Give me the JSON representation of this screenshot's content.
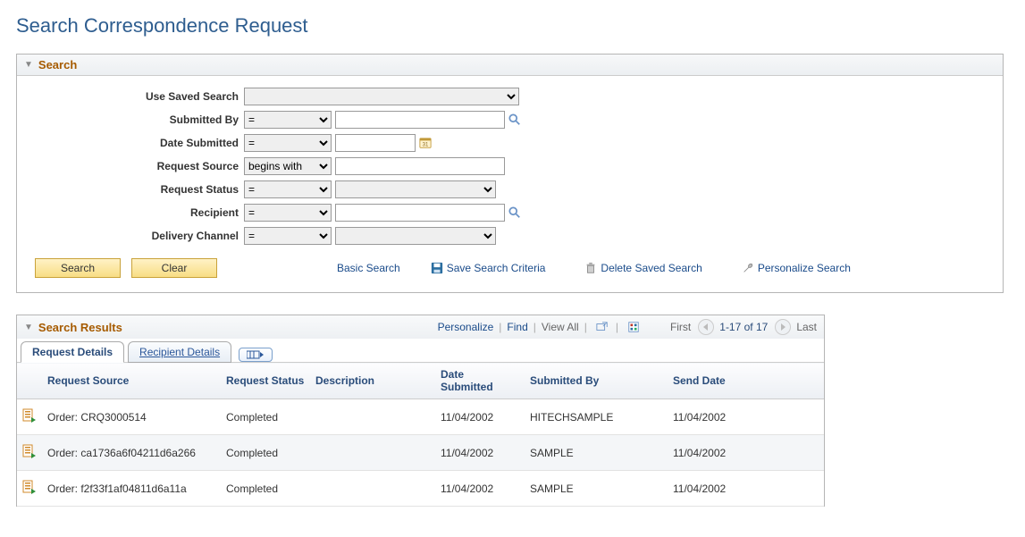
{
  "page": {
    "title": "Search Correspondence Request"
  },
  "searchPanel": {
    "title": "Search",
    "fields": {
      "useSavedSearch": {
        "label": "Use Saved Search",
        "value": ""
      },
      "submittedBy": {
        "label": "Submitted By",
        "op": "=",
        "value": ""
      },
      "dateSubmitted": {
        "label": "Date Submitted",
        "op": "=",
        "value": ""
      },
      "requestSource": {
        "label": "Request Source",
        "op": "begins with",
        "value": ""
      },
      "requestStatus": {
        "label": "Request Status",
        "op": "=",
        "value": ""
      },
      "recipient": {
        "label": "Recipient",
        "op": "=",
        "value": ""
      },
      "deliveryChannel": {
        "label": "Delivery Channel",
        "op": "=",
        "value": ""
      }
    },
    "buttons": {
      "search": "Search",
      "clear": "Clear"
    },
    "links": {
      "basicSearch": "Basic Search",
      "saveCriteria": "Save Search Criteria",
      "deleteSaved": "Delete Saved Search",
      "personalize": "Personalize Search"
    }
  },
  "resultsPanel": {
    "title": "Search Results",
    "toolbar": {
      "personalize": "Personalize",
      "find": "Find",
      "viewAll": "View All",
      "firstLabel": "First",
      "rangeLabel": "1-17 of 17",
      "lastLabel": "Last"
    },
    "tabs": {
      "requestDetails": "Request Details",
      "recipientDetails": "Recipient Details"
    },
    "columns": {
      "requestSource": "Request Source",
      "requestStatus": "Request Status",
      "description": "Description",
      "dateSubmitted": "Date Submitted",
      "submittedBy": "Submitted By",
      "sendDate": "Send Date"
    },
    "rows": [
      {
        "requestSource": "Order: CRQ3000514",
        "requestStatus": "Completed",
        "description": "",
        "dateSubmitted": "11/04/2002",
        "submittedBy": "HITECHSAMPLE",
        "sendDate": "11/04/2002"
      },
      {
        "requestSource": "Order: ca1736a6f04211d6a266",
        "requestStatus": "Completed",
        "description": "",
        "dateSubmitted": "11/04/2002",
        "submittedBy": "SAMPLE",
        "sendDate": "11/04/2002"
      },
      {
        "requestSource": "Order: f2f33f1af04811d6a11a",
        "requestStatus": "Completed",
        "description": "",
        "dateSubmitted": "11/04/2002",
        "submittedBy": "SAMPLE",
        "sendDate": "11/04/2002"
      }
    ]
  }
}
